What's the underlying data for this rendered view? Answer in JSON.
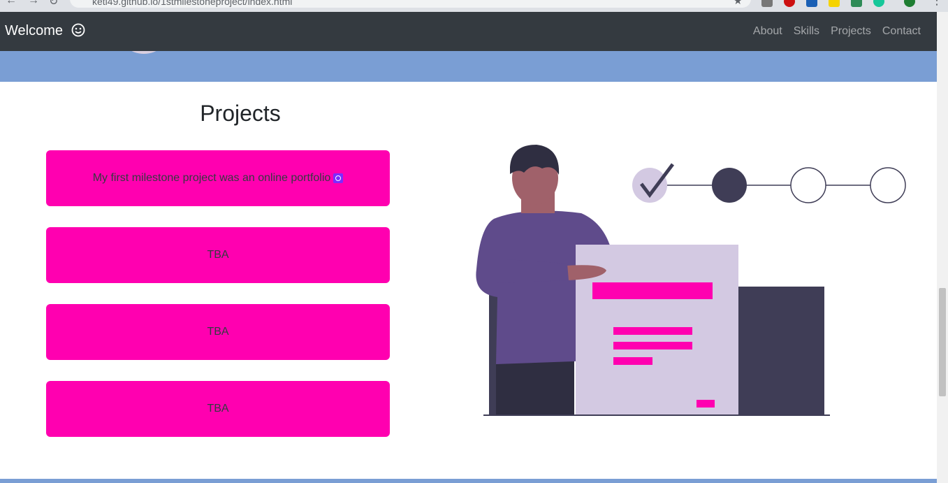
{
  "browser": {
    "url": "ketl49.github.io/1stmilestoneproject/index.html",
    "icons": [
      "back-icon",
      "forward-icon",
      "reload-icon",
      "star-icon",
      "menu-icon"
    ]
  },
  "navbar": {
    "brand": "Welcome",
    "brand_icon": "smiley-icon",
    "links": [
      {
        "label": "About"
      },
      {
        "label": "Skills"
      },
      {
        "label": "Projects"
      },
      {
        "label": "Contact"
      }
    ],
    "background": "#343a40"
  },
  "hero": {
    "background": "#7a9ed4"
  },
  "projects": {
    "title": "Projects",
    "cards": [
      {
        "text": "My first milestone project was an online portfolio",
        "icon": "github-icon"
      },
      {
        "text": "TBA"
      },
      {
        "text": "TBA"
      },
      {
        "text": "TBA"
      }
    ],
    "card_color": "#ff00b0"
  },
  "colors": {
    "accent": "#ff00b0",
    "dark_purple": "#3f3d56",
    "light_purple": "#d3c9e2",
    "shirt": "#5f4b8b"
  }
}
